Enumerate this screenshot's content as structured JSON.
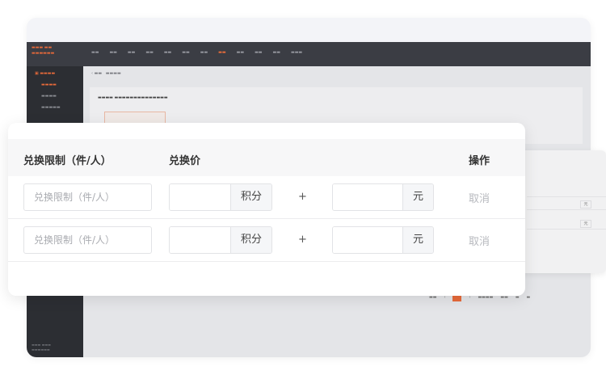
{
  "table": {
    "headers": {
      "limit": "兑换限制（件/人）",
      "price": "兑换价",
      "action": "操作"
    },
    "rows": [
      {
        "limit_placeholder": "兑换限制（件/人）",
        "points_value": "",
        "points_unit": "积分",
        "plus": "+",
        "cash_value": "",
        "cash_unit": "元",
        "cancel_label": "取消"
      },
      {
        "limit_placeholder": "兑换限制（件/人）",
        "points_value": "",
        "points_unit": "积分",
        "plus": "+",
        "cash_value": "",
        "cash_unit": "元",
        "cancel_label": "取消"
      }
    ]
  },
  "background_app": {
    "side_panel_unit": "元"
  },
  "colors": {
    "accent": "#e86a3a",
    "topbar": "#3b3d44",
    "sidebar": "#2c2e33",
    "cancel_text": "#b7b9be",
    "header_bg": "#f7f7f8"
  }
}
